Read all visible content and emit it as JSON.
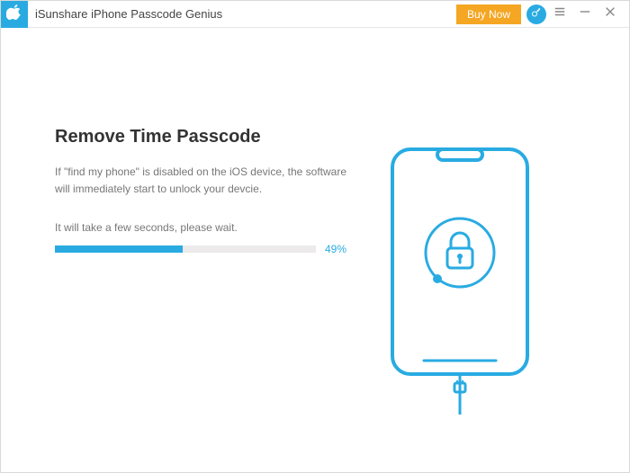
{
  "titlebar": {
    "app_name": "iSunshare iPhone Passcode Genius",
    "buy_label": "Buy Now"
  },
  "main": {
    "heading": "Remove Time Passcode",
    "description": "If \"find my phone\" is disabled on the iOS device, the software will immediately start to unlock your devcie.",
    "wait_text": "It will take a few seconds, please wait.",
    "progress_percent": 49,
    "progress_label": "49%"
  },
  "icons": {
    "logo": "apple-logo",
    "key": "key-icon",
    "menu": "hamburger-icon",
    "minimize": "minimize-icon",
    "close": "close-icon",
    "phone": "phone-lock-illustration"
  },
  "colors": {
    "accent": "#29abe2",
    "buy": "#f5a623"
  }
}
